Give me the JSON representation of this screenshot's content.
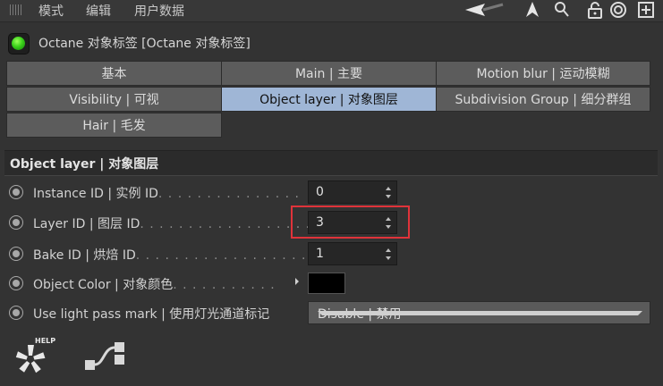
{
  "menubar": {
    "items": [
      "模式",
      "编辑",
      "用户数据"
    ]
  },
  "toolbar": {
    "icons": [
      "back-arrow-icon",
      "cursor-arrow-icon",
      "search-icon",
      "lock-icon",
      "target-icon",
      "add-icon"
    ]
  },
  "header": {
    "title": "Octane 对象标签 [Octane 对象标签]"
  },
  "tabs": [
    {
      "label": "基本",
      "active": false
    },
    {
      "label": "Main | 主要",
      "active": false
    },
    {
      "label": "Motion blur | 运动模糊",
      "active": false
    },
    {
      "label": "Visibility | 可视",
      "active": false
    },
    {
      "label": "Object layer | 对象图层",
      "active": true
    },
    {
      "label": "Subdivision Group | 细分群组",
      "active": false
    },
    {
      "label": "Hair | 毛发",
      "active": false
    }
  ],
  "section": {
    "title": "Object layer | 对象图层"
  },
  "fields": {
    "instance_id": {
      "label": "Instance ID | 实例 ID",
      "dots": ". . . . . . . . . . . . . . .",
      "value": "0"
    },
    "layer_id": {
      "label": "Layer ID | 图层 ID",
      "dots": ". . . . . . . . . . . . . . . . . .",
      "value": "3"
    },
    "bake_id": {
      "label": "Bake ID | 烘焙 ID",
      "dots": ". . . . . . . . . . . . . . . . . .",
      "value": "1"
    },
    "object_color": {
      "label": "Object Color | 对象颜色",
      "dots": ". . . . . . . . . . .",
      "value": "#000000"
    },
    "light_pass": {
      "label": "Use light pass mark | 使用灯光通道标记",
      "value": "Disable | 禁用"
    }
  },
  "footer": {
    "help_label": "HELP",
    "icons": [
      "octane-help-icon",
      "node-editor-icon"
    ]
  },
  "colors": {
    "background": "#333333",
    "tab": "#5c5c5c",
    "tab_active": "#9fb6d6",
    "highlight": "#e0333a",
    "status_green": "#3ad01a"
  }
}
